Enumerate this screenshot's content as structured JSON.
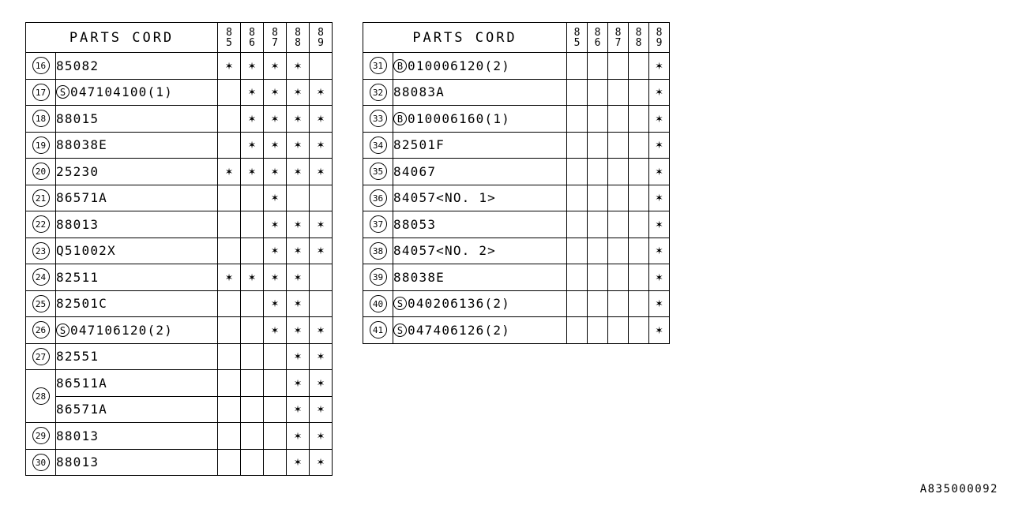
{
  "document": {
    "reference_code": "A835000092"
  },
  "tables": [
    {
      "id": "left",
      "header": {
        "title": "PARTS CORD",
        "years": [
          "85",
          "86",
          "87",
          "88",
          "89"
        ]
      },
      "dashed_after_year_index": 3,
      "rows": [
        {
          "index": "16",
          "prefix": "",
          "name": "85082",
          "marks": [
            true,
            true,
            true,
            true,
            false
          ]
        },
        {
          "index": "17",
          "prefix": "S",
          "name": "047104100(1)",
          "marks": [
            false,
            true,
            true,
            true,
            true
          ]
        },
        {
          "index": "18",
          "prefix": "",
          "name": "88015",
          "marks": [
            false,
            true,
            true,
            true,
            true
          ]
        },
        {
          "index": "19",
          "prefix": "",
          "name": "88038E",
          "marks": [
            false,
            true,
            true,
            true,
            true
          ]
        },
        {
          "index": "20",
          "prefix": "",
          "name": "25230",
          "marks": [
            true,
            true,
            true,
            true,
            true
          ]
        },
        {
          "index": "21",
          "prefix": "",
          "name": "86571A",
          "marks": [
            false,
            false,
            true,
            false,
            false
          ]
        },
        {
          "index": "22",
          "prefix": "",
          "name": "88013",
          "marks": [
            false,
            false,
            true,
            true,
            true
          ]
        },
        {
          "index": "23",
          "prefix": "",
          "name": "Q51002X",
          "marks": [
            false,
            false,
            true,
            true,
            true
          ]
        },
        {
          "index": "24",
          "prefix": "",
          "name": "82511",
          "marks": [
            true,
            true,
            true,
            true,
            false
          ]
        },
        {
          "index": "25",
          "prefix": "",
          "name": "82501C",
          "marks": [
            false,
            false,
            true,
            true,
            false
          ]
        },
        {
          "index": "26",
          "prefix": "S",
          "name": "047106120(2)",
          "marks": [
            false,
            false,
            true,
            true,
            true
          ]
        },
        {
          "index": "27",
          "prefix": "",
          "name": "82551",
          "marks": [
            false,
            false,
            false,
            true,
            true
          ]
        },
        {
          "index": "28",
          "prefix": "",
          "name": "86511A",
          "marks": [
            false,
            false,
            false,
            true,
            true
          ],
          "group_start": true,
          "group_span": 2
        },
        {
          "index": "",
          "prefix": "",
          "name": "86571A",
          "marks": [
            false,
            false,
            false,
            true,
            true
          ],
          "group_member": true
        },
        {
          "index": "29",
          "prefix": "",
          "name": "88013",
          "marks": [
            false,
            false,
            false,
            true,
            true
          ]
        },
        {
          "index": "30",
          "prefix": "",
          "name": "88013",
          "marks": [
            false,
            false,
            false,
            true,
            true
          ]
        }
      ]
    },
    {
      "id": "right",
      "header": {
        "title": "PARTS CORD",
        "years": [
          "85",
          "86",
          "87",
          "88",
          "89"
        ]
      },
      "dashed_after_year_index": -1,
      "rows": [
        {
          "index": "31",
          "prefix": "B",
          "name": "010006120(2)",
          "marks": [
            false,
            false,
            false,
            false,
            true
          ]
        },
        {
          "index": "32",
          "prefix": "",
          "name": "88083A",
          "marks": [
            false,
            false,
            false,
            false,
            true
          ]
        },
        {
          "index": "33",
          "prefix": "B",
          "name": "010006160(1)",
          "marks": [
            false,
            false,
            false,
            false,
            true
          ]
        },
        {
          "index": "34",
          "prefix": "",
          "name": "82501F",
          "marks": [
            false,
            false,
            false,
            false,
            true
          ]
        },
        {
          "index": "35",
          "prefix": "",
          "name": "84067",
          "marks": [
            false,
            false,
            false,
            false,
            true
          ]
        },
        {
          "index": "36",
          "prefix": "",
          "name": "84057<NO. 1>",
          "marks": [
            false,
            false,
            false,
            false,
            true
          ]
        },
        {
          "index": "37",
          "prefix": "",
          "name": "88053",
          "marks": [
            false,
            false,
            false,
            false,
            true
          ]
        },
        {
          "index": "38",
          "prefix": "",
          "name": "84057<NO. 2>",
          "marks": [
            false,
            false,
            false,
            false,
            true
          ]
        },
        {
          "index": "39",
          "prefix": "",
          "name": "88038E",
          "marks": [
            false,
            false,
            false,
            false,
            true
          ]
        },
        {
          "index": "40",
          "prefix": "S",
          "name": "040206136(2)",
          "marks": [
            false,
            false,
            false,
            false,
            true
          ]
        },
        {
          "index": "41",
          "prefix": "S",
          "name": "047406126(2)",
          "marks": [
            false,
            false,
            false,
            false,
            true
          ]
        }
      ]
    }
  ],
  "symbols": {
    "mark": "✶"
  }
}
